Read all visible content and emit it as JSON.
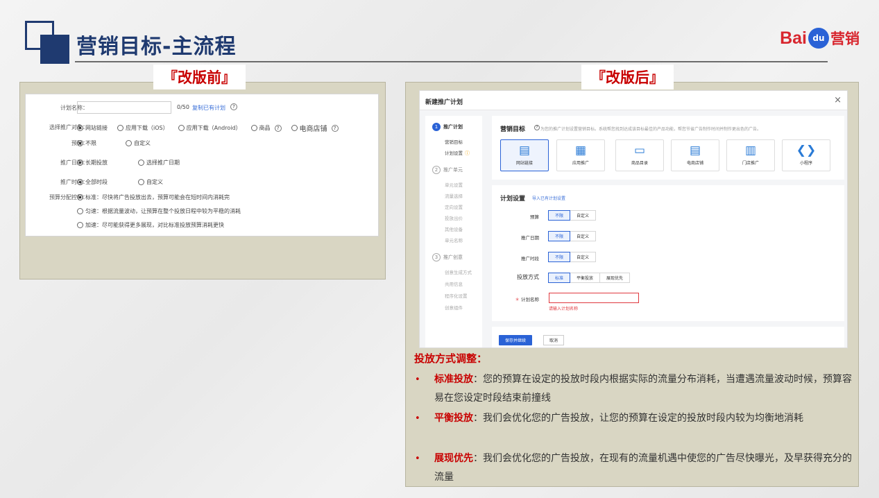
{
  "header": {
    "title": "营销目标-主流程",
    "brand_bai": "Bai",
    "brand_du": "du",
    "brand_marketing": "营销"
  },
  "labels": {
    "before": "『改版前』",
    "after": "『改版后』"
  },
  "before_form": {
    "plan_name_label": "计划名称：",
    "plan_name_count": "0/50",
    "copy_link": "复制已有计划",
    "target_label": "选择推广对象：",
    "target_options": [
      "网站链接",
      "应用下载（iOS）",
      "应用下载（Android）",
      "商品",
      "电商店铺"
    ],
    "budget_label": "预算：",
    "budget_options": [
      "不限",
      "自定义"
    ],
    "date_label": "推广日期：",
    "date_options": [
      "长期投放",
      "选择推广日期"
    ],
    "time_label": "推广时段：",
    "time_options": [
      "全部时段",
      "自定义"
    ],
    "pacing_label": "预算分配控制：",
    "pacing_options": [
      "标准：尽快将广告投放出去，预算可能会在短时间内消耗完",
      "匀速：根据流量波动，让预算在整个投放日程中较为平稳的消耗",
      "加速：尽可能获得更多展现，对比标准投放预算消耗更快"
    ]
  },
  "dialog": {
    "title": "新建推广计划",
    "close": "×",
    "steps": [
      {
        "num": "1",
        "label": "推广计划",
        "subs": [
          "营销目标",
          "计划设置"
        ]
      },
      {
        "num": "2",
        "label": "推广单元",
        "subs": [
          "单元设置",
          "流量选择",
          "定向设置",
          "投放出价",
          "其他设备",
          "单元名称"
        ]
      },
      {
        "num": "3",
        "label": "推广创意",
        "subs": [
          "创意生成方式",
          "共用信息",
          "程序化设置",
          "创意组件"
        ]
      }
    ],
    "warn_icon": "ⓘ",
    "goal": {
      "heading": "营销目标",
      "desc": "为您的推广计划设置营销目标。系统帮您找到达成该目标最佳的产品功能，帮您节省广告制作时间并制作更出色的广告。",
      "options": [
        {
          "label": "网站链接",
          "icon": "▤"
        },
        {
          "label": "应用推广",
          "icon": "▦"
        },
        {
          "label": "商品目录",
          "icon": "▭"
        },
        {
          "label": "电商店铺",
          "icon": "▤"
        },
        {
          "label": "门店推广",
          "icon": "▥"
        },
        {
          "label": "小程序",
          "icon": "❮❯"
        }
      ]
    },
    "plan": {
      "heading": "计划设置",
      "import_link": "导入已有计划设置",
      "budget_label": "预算",
      "date_label": "推广日期",
      "time_label": "推广时段",
      "method_label": "投放方式",
      "name_label": "计划名称",
      "required_mark": "＊",
      "unlimited": "不限",
      "custom": "自定义",
      "methods": [
        "标准",
        "平衡投放",
        "展现优先"
      ],
      "name_error": "请输入计划名称"
    },
    "save_button": "保存并继续",
    "cancel_button": "取消"
  },
  "explanation": {
    "heading": "投放方式调整",
    "colon": "：",
    "bullet": "•",
    "items": [
      {
        "term": "标准投放",
        "text": "：您的预算在设定的投放时段内根据实际的流量分布消耗，当遭遇流量波动时候，预算容易在您设定时段结束前撞线"
      },
      {
        "term": "平衡投放",
        "text": "：我们会优化您的广告投放，让您的预算在设定的投放时段内较为均衡地消耗"
      },
      {
        "term": "展现优先",
        "text": "：我们会优化您的广告投放，在现有的流量机遇中使您的广告尽快曝光，及早获得充分的流量"
      }
    ]
  }
}
